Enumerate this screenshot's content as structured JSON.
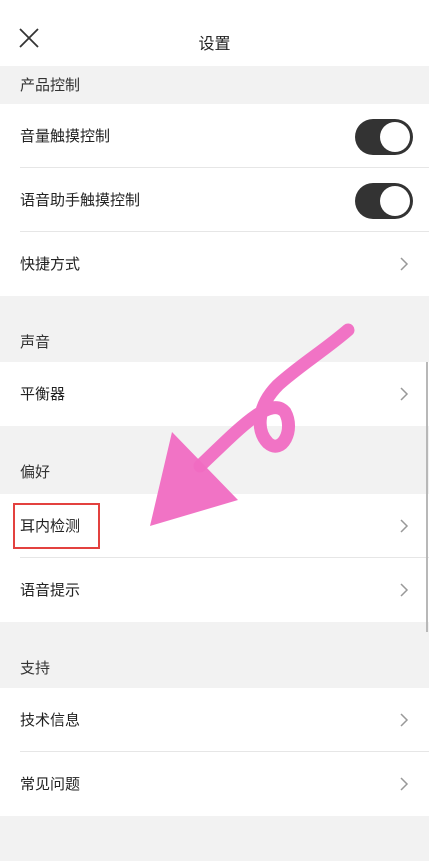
{
  "header": {
    "title": "设置"
  },
  "sections": {
    "product_control": {
      "title": "产品控制",
      "items": [
        {
          "label": "音量触摸控制",
          "type": "toggle",
          "on": true
        },
        {
          "label": "语音助手触摸控制",
          "type": "toggle",
          "on": true
        },
        {
          "label": "快捷方式",
          "type": "link"
        }
      ]
    },
    "sound": {
      "title": "声音",
      "items": [
        {
          "label": "平衡器",
          "type": "link"
        }
      ]
    },
    "preferences": {
      "title": "偏好",
      "items": [
        {
          "label": "耳内检测",
          "type": "link"
        },
        {
          "label": "语音提示",
          "type": "link"
        }
      ]
    },
    "support": {
      "title": "支持",
      "items": [
        {
          "label": "技术信息",
          "type": "link"
        },
        {
          "label": "常见问题",
          "type": "link"
        }
      ]
    }
  },
  "annotation": {
    "highlight_color": "#e3413f",
    "arrow_color": "#f06bc2"
  },
  "icons": {
    "close": "close-icon",
    "chevron": "chevron-right-icon"
  }
}
